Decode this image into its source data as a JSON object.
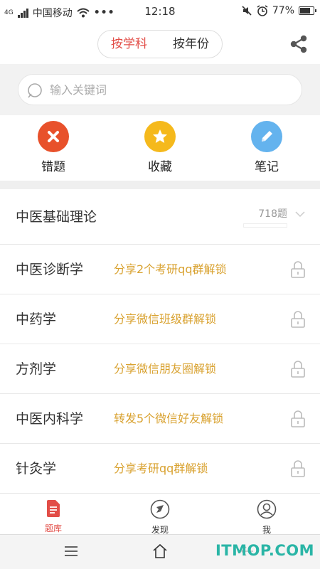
{
  "status": {
    "network_badge": "4G",
    "carrier": "中国移动",
    "time": "12:18",
    "battery": "77%"
  },
  "header": {
    "tabs": [
      "按学科",
      "按年份"
    ]
  },
  "search": {
    "placeholder": "输入关键词"
  },
  "actions": [
    {
      "label": "错题",
      "icon": "close-icon",
      "color": "#e8512b"
    },
    {
      "label": "收藏",
      "icon": "star-icon",
      "color": "#f5b91c"
    },
    {
      "label": "笔记",
      "icon": "pencil-icon",
      "color": "#64b3ee"
    }
  ],
  "subjects": [
    {
      "name": "中医基础理论",
      "count": "718题"
    },
    {
      "name": "中医诊断学",
      "hint": "分享2个考研qq群解锁"
    },
    {
      "name": "中药学",
      "hint": "分享微信班级群解锁"
    },
    {
      "name": "方剂学",
      "hint": "分享微信朋友圈解锁"
    },
    {
      "name": "中医内科学",
      "hint": "转发5个微信好友解锁"
    },
    {
      "name": "针灸学",
      "hint": "分享考研qq群解锁"
    }
  ],
  "tabbar": [
    {
      "label": "题库",
      "icon": "document-icon",
      "active": true
    },
    {
      "label": "发现",
      "icon": "compass-icon",
      "active": false
    },
    {
      "label": "我",
      "icon": "user-icon",
      "active": false
    }
  ],
  "watermark": "ITMOP.COM",
  "colors": {
    "accent": "#e24d47",
    "hint": "#d9a230",
    "watermark": "#2ab5a6"
  }
}
